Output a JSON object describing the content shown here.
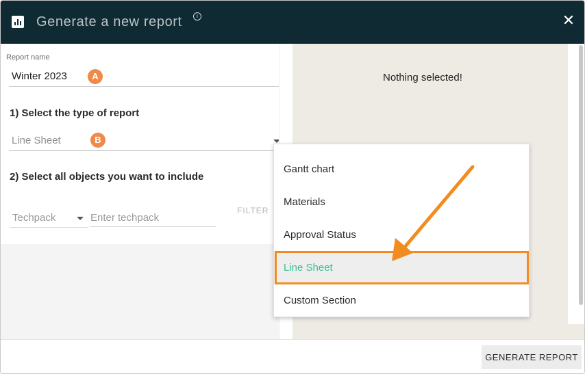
{
  "header": {
    "title": "Generate a new report",
    "info_glyph": "i",
    "close_glyph": "✕",
    "icon": "bar-chart-icon",
    "background": "#0f2a33"
  },
  "form": {
    "report_name_label": "Report name",
    "report_name_value": "Winter 2023",
    "marker_a": "A",
    "step1_heading": "1) Select the type of report",
    "report_type_value": "Line Sheet",
    "marker_b": "B",
    "step2_heading": "2) Select all objects you want to include",
    "object_type_value": "Techpack",
    "object_input_placeholder": "Enter techpack",
    "filter_label": "FILTER",
    "marker_color": "#f08a4b"
  },
  "preview": {
    "empty_text": "Nothing selected!"
  },
  "dropdown": {
    "options": [
      "Gantt chart",
      "Materials",
      "Approval Status",
      "Line Sheet",
      "Custom Section"
    ],
    "selected": "Line Sheet",
    "selected_color": "#3cbf8f",
    "highlight_color": "#f28c1e"
  },
  "footer": {
    "generate_label": "GENERATE REPORT"
  }
}
